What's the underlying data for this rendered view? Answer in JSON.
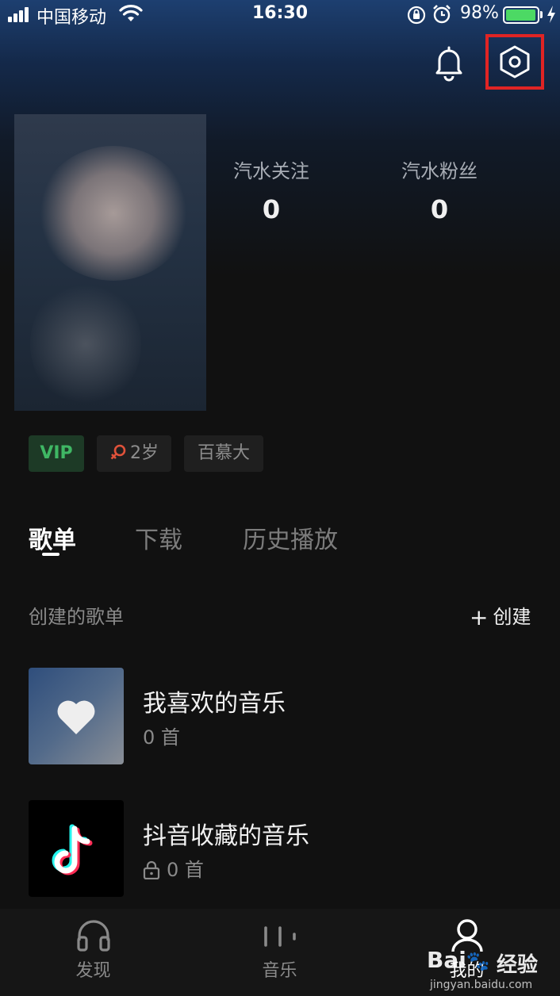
{
  "status_bar": {
    "carrier": "中国移动",
    "time": "16:30",
    "battery_percent": "98%",
    "battery_level": 0.98,
    "battery_color": "#4cd964"
  },
  "header": {
    "bell_icon": "bell-icon",
    "settings_icon": "settings-hexagon-icon",
    "highlight_color": "#e02424"
  },
  "profile": {
    "stats": [
      {
        "label": "汽水关注",
        "value": "0"
      },
      {
        "label": "汽水粉丝",
        "value": "0"
      }
    ],
    "tags": {
      "vip": "VIP",
      "age": "2岁",
      "place": "百慕大"
    }
  },
  "tabs": [
    {
      "label": "歌单",
      "active": true
    },
    {
      "label": "下载",
      "active": false
    },
    {
      "label": "历史播放",
      "active": false
    }
  ],
  "section": {
    "title": "创建的歌单",
    "create_label": "创建"
  },
  "playlists": [
    {
      "title": "我喜欢的音乐",
      "count": "0 首",
      "icon": "heart-icon",
      "locked": false
    },
    {
      "title": "抖音收藏的音乐",
      "count": "0 首",
      "icon": "tiktok-icon",
      "locked": true
    }
  ],
  "bottom_nav": [
    {
      "label": "发现",
      "icon": "headphones-icon",
      "active": false
    },
    {
      "label": "音乐",
      "icon": "equalizer-icon",
      "active": false
    },
    {
      "label": "我的",
      "icon": "user-icon",
      "active": true
    }
  ],
  "watermark": {
    "text": "经验",
    "url": "jingyan.baidu.com"
  }
}
